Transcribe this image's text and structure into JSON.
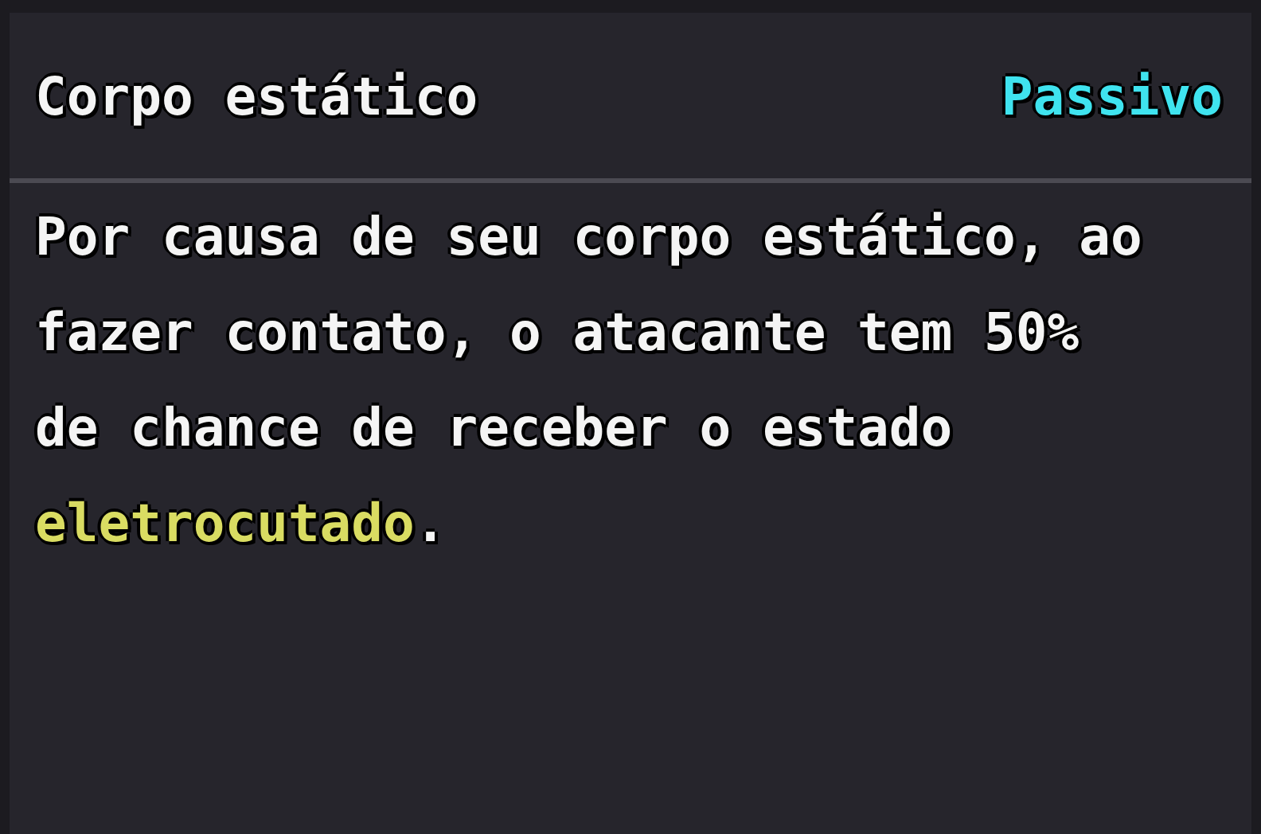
{
  "tooltip": {
    "title": "Corpo estático",
    "type_label": "Passivo",
    "description": [
      {
        "kind": "plain",
        "text": "Por causa de seu corpo estático, ao fazer contato, o atacante tem 50% de chance de receber o estado "
      },
      {
        "kind": "keyword",
        "text": "eletrocutado"
      },
      {
        "kind": "plain",
        "text": "."
      }
    ]
  }
}
